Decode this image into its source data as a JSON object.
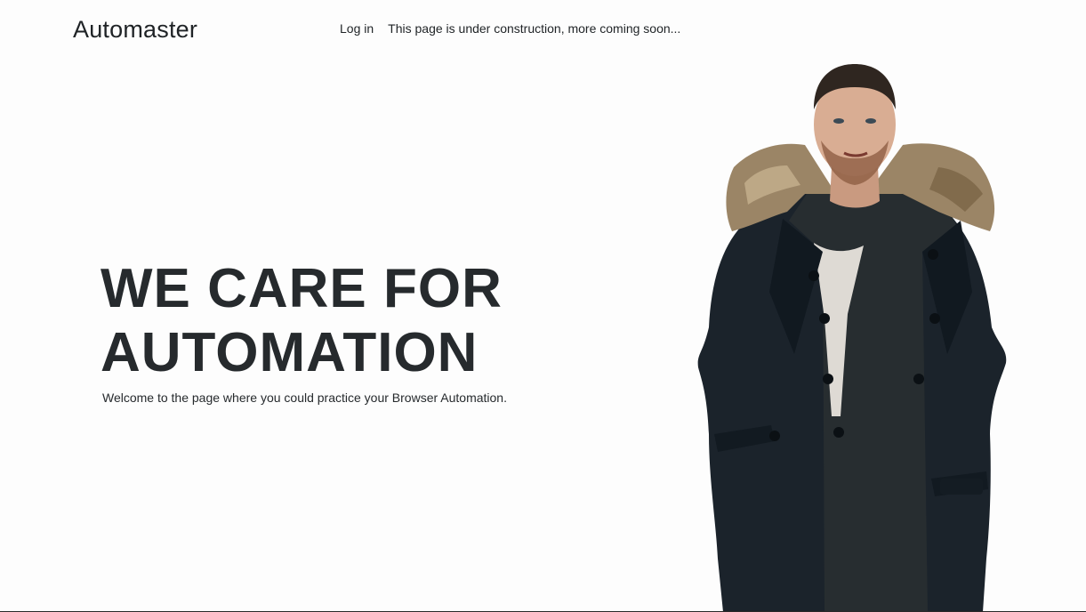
{
  "header": {
    "brand": "Automaster",
    "nav": {
      "login_label": "Log in",
      "construction_notice": "This page is under construction, more coming soon..."
    }
  },
  "hero": {
    "title_line1": "WE CARE FOR",
    "title_line2": "AUTOMATION",
    "subtitle": "Welcome to the page where you could practice your Browser Automation."
  },
  "colors": {
    "background": "#fdfdfd",
    "text": "#23272a",
    "coat": "#1b232b",
    "fur": "#9b8566"
  }
}
